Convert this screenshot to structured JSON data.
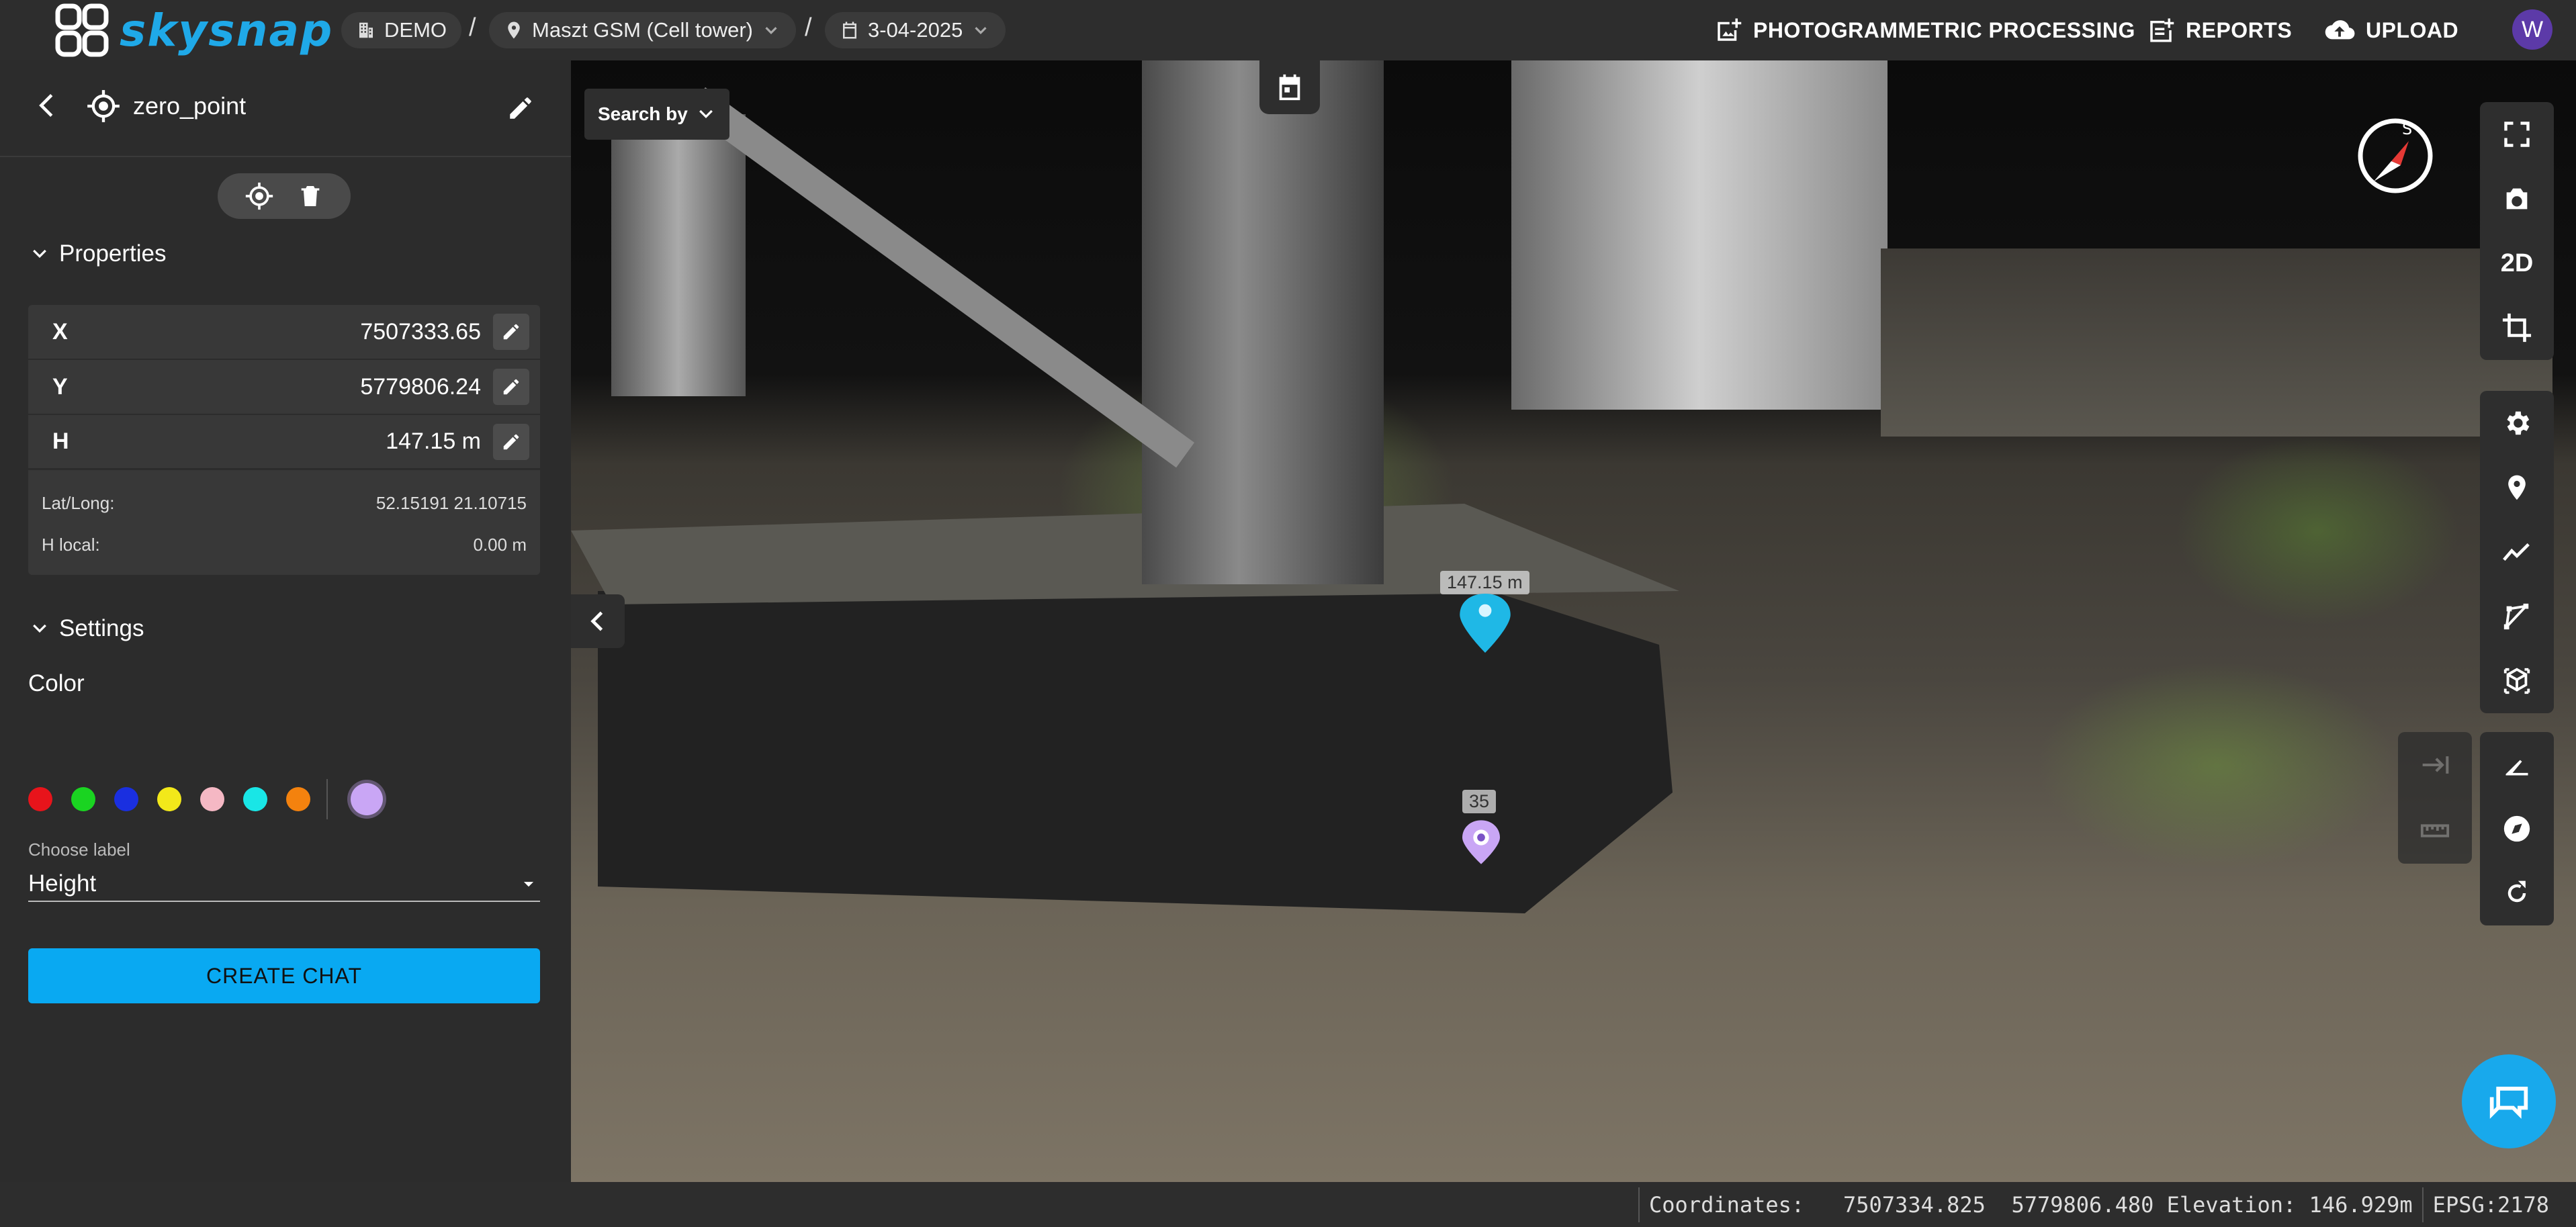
{
  "header": {
    "logo_text": "skysnap",
    "breadcrumbs": [
      {
        "label": "DEMO"
      },
      {
        "label": "Maszt GSM (Cell tower)"
      },
      {
        "label": "3-04-2025"
      }
    ],
    "separator": "/",
    "nav": {
      "photogrammetric": "PHOTOGRAMMETRIC PROCESSING",
      "reports": "REPORTS",
      "upload": "UPLOAD"
    },
    "avatar_initial": "W"
  },
  "sidebar": {
    "point_name": "zero_point",
    "properties": {
      "title": "Properties",
      "x_label": "X",
      "x_value": "7507333.65",
      "y_label": "Y",
      "y_value": "5779806.24",
      "h_label": "H",
      "h_value": "147.15 m",
      "latlong_label": "Lat/Long:",
      "latlong_value": "52.15191 21.10715",
      "hlocal_label": "H local:",
      "hlocal_value": "0.00 m"
    },
    "settings": {
      "title": "Settings",
      "color_label": "Color",
      "colors": [
        "#e8141b",
        "#1ad421",
        "#1a2fe0",
        "#f2e81a",
        "#f5b8c4",
        "#19e6e6",
        "#f4820e"
      ],
      "selected_color": "#c9a6f5",
      "choose_label_caption": "Choose label",
      "choose_label_value": "Height"
    },
    "create_chat": "CREATE CHAT"
  },
  "viewer": {
    "search_by": "Search by",
    "toolbar_2d": "2D",
    "marker_height_label": "147.15 m",
    "marker_number_label": "35"
  },
  "status": {
    "coordinates_label": "Coordinates:",
    "coord_x": "7507334.825",
    "coord_y": "5779806.480",
    "elevation": "Elevation: 146.929m",
    "epsg": "EPSG:2178"
  }
}
